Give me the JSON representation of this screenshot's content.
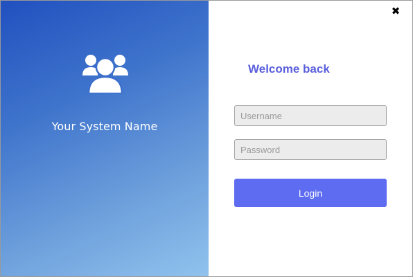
{
  "brand": {
    "icon": "users-group-icon",
    "system_name": "Your System Name"
  },
  "window": {
    "close_glyph": "✖",
    "close_icon": "close-icon"
  },
  "login": {
    "title": "Welcome back",
    "username_placeholder": "Username",
    "username_value": "",
    "password_placeholder": "Password",
    "password_value": "",
    "button_label": "Login"
  },
  "colors": {
    "gradient_start": "#2150bf",
    "gradient_end": "#91c3ee",
    "title": "#5a5fdc",
    "button": "#5d6cf0",
    "field_background": "#ececec"
  }
}
